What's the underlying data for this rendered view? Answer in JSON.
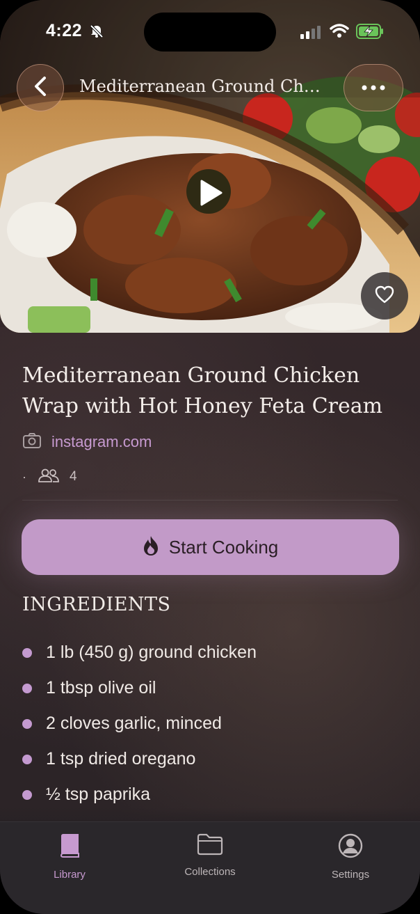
{
  "status_bar": {
    "time": "4:22"
  },
  "nav": {
    "title": "Mediterranean Ground Ch…"
  },
  "recipe": {
    "title": "Mediterranean Ground Chicken Wrap with Hot Honey Feta Cream",
    "source": "instagram.com",
    "meta_separator": "·",
    "servings": "4"
  },
  "actions": {
    "start_cooking": "Start Cooking"
  },
  "ingredients": {
    "heading": "INGREDIENTS",
    "items": [
      "1 lb (450 g) ground chicken",
      "1 tbsp olive oil",
      "2 cloves garlic, minced",
      "1 tsp dried oregano",
      "½ tsp paprika"
    ]
  },
  "tabbar": {
    "library": "Library",
    "collections": "Collections",
    "settings": "Settings"
  },
  "colors": {
    "accent": "#c29ac8",
    "link": "#c79ad0",
    "background": "#33272a",
    "tabbar": "#2a272b"
  },
  "icons": {
    "back": "chevron-left-icon",
    "more": "ellipsis-icon",
    "play": "play-icon",
    "favorite": "heart-icon",
    "source": "camera-icon",
    "servings": "people-icon",
    "cook": "flame-icon",
    "library": "book-icon",
    "collections": "folder-icon",
    "settings": "person-circle-icon"
  }
}
